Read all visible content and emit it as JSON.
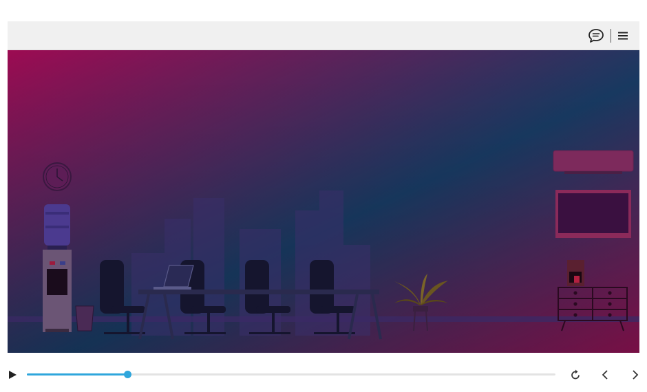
{
  "player": {
    "accent_color": "#2fa6dc",
    "topbar": {
      "icons": [
        "speech-bubble-icon",
        "hamburger-menu-icon"
      ]
    },
    "slide": {
      "scene": "office-meeting-room-illustration",
      "gradient_colors": [
        "#9c0b52",
        "#183a62",
        "#8c1251"
      ]
    },
    "controls": {
      "progress": 0.19,
      "icons": [
        "play-icon",
        "replay-icon",
        "previous-icon",
        "next-icon"
      ]
    }
  }
}
